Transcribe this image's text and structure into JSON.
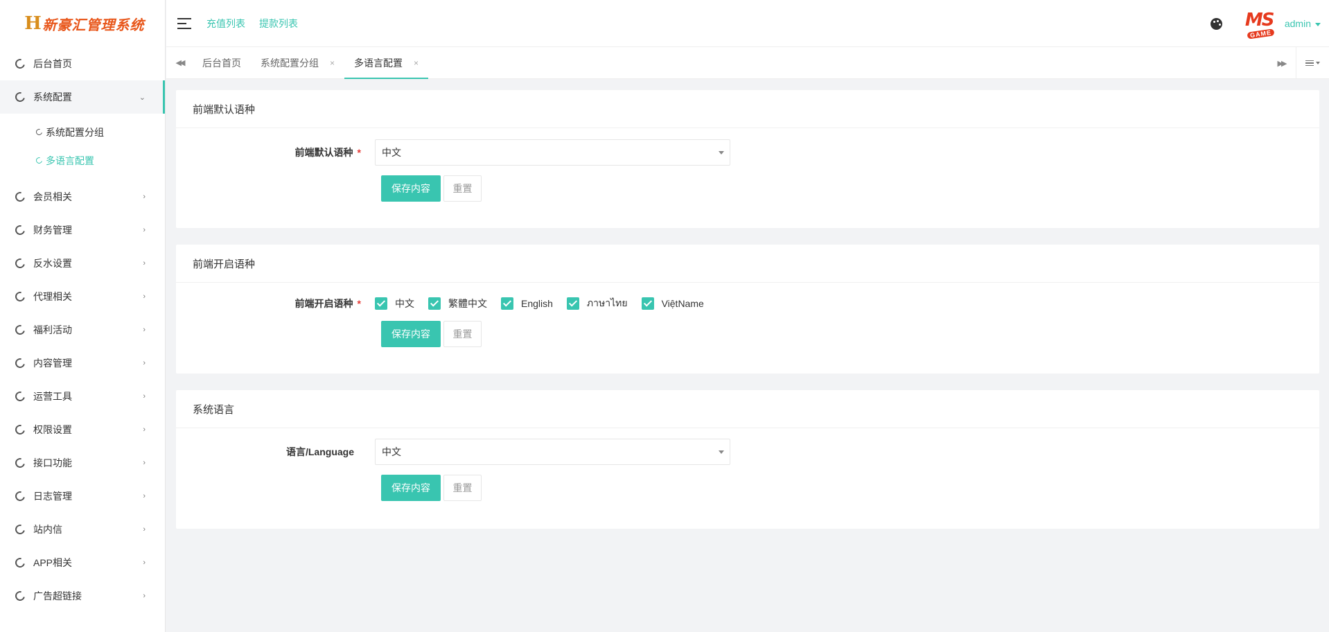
{
  "app": {
    "logo_mark": "H",
    "logo_text": "新豪汇管理系统"
  },
  "header": {
    "links": [
      "充值列表",
      "提款列表"
    ],
    "user_name": "admin",
    "avatar_text_top": "MS",
    "avatar_text_bottom": "GAME",
    "accent_color": "#39c5b0"
  },
  "sidebar": {
    "items": [
      {
        "label": "后台首页"
      },
      {
        "label": "系统配置",
        "open": true,
        "children": [
          {
            "label": "系统配置分组"
          },
          {
            "label": "多语言配置",
            "active": true
          }
        ]
      },
      {
        "label": "会员相关"
      },
      {
        "label": "财务管理"
      },
      {
        "label": "反水设置"
      },
      {
        "label": "代理相关"
      },
      {
        "label": "福利活动"
      },
      {
        "label": "内容管理"
      },
      {
        "label": "运营工具"
      },
      {
        "label": "权限设置"
      },
      {
        "label": "接口功能"
      },
      {
        "label": "日志管理"
      },
      {
        "label": "站内信"
      },
      {
        "label": "APP相关"
      },
      {
        "label": "广告超链接"
      }
    ]
  },
  "tabs": [
    {
      "label": "后台首页",
      "closable": false
    },
    {
      "label": "系统配置分组",
      "closable": true
    },
    {
      "label": "多语言配置",
      "closable": true,
      "active": true
    }
  ],
  "cards": {
    "default_lang": {
      "title": "前端默认语种",
      "label": "前端默认语种",
      "value": "中文",
      "save": "保存内容",
      "reset": "重置"
    },
    "enabled_langs": {
      "title": "前端开启语种",
      "label": "前端开启语种",
      "options": [
        {
          "label": "中文",
          "checked": true
        },
        {
          "label": "繁體中文",
          "checked": true
        },
        {
          "label": "English",
          "checked": true
        },
        {
          "label": "ภาษาไทย",
          "checked": true
        },
        {
          "label": "ViệtName",
          "checked": true
        }
      ],
      "save": "保存内容",
      "reset": "重置"
    },
    "system_lang": {
      "title": "系统语言",
      "label": "语言/Language",
      "value": "中文",
      "save": "保存内容",
      "reset": "重置"
    }
  }
}
